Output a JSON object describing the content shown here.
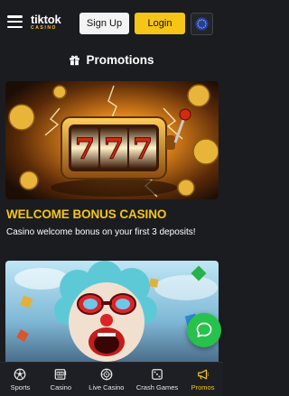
{
  "header": {
    "logo_main": "tiktok",
    "logo_sub": "CASINO",
    "signup_label": "Sign Up",
    "login_label": "Login",
    "language_icon": "eu-flag-icon"
  },
  "page": {
    "title": "Promotions",
    "title_icon": "gift-icon"
  },
  "promotions": [
    {
      "title": "WELCOME BONUS CASINO",
      "description": "Casino welcome bonus on your first 3 deposits!",
      "slot_reels": [
        "7",
        "7",
        "7"
      ]
    },
    {
      "title": "",
      "description": ""
    }
  ],
  "bottom_nav": [
    {
      "label": "Sports",
      "icon": "soccer-ball-icon",
      "active": false
    },
    {
      "label": "Casino",
      "icon": "slot-machine-icon",
      "active": false
    },
    {
      "label": "Live Casino",
      "icon": "roulette-icon",
      "active": false
    },
    {
      "label": "Crash Games",
      "icon": "dice-icon",
      "active": false
    },
    {
      "label": "Promos",
      "icon": "megaphone-icon",
      "active": true
    }
  ],
  "colors": {
    "background": "#1b1c20",
    "accent": "#f5c518",
    "chat_green": "#27c24c"
  }
}
